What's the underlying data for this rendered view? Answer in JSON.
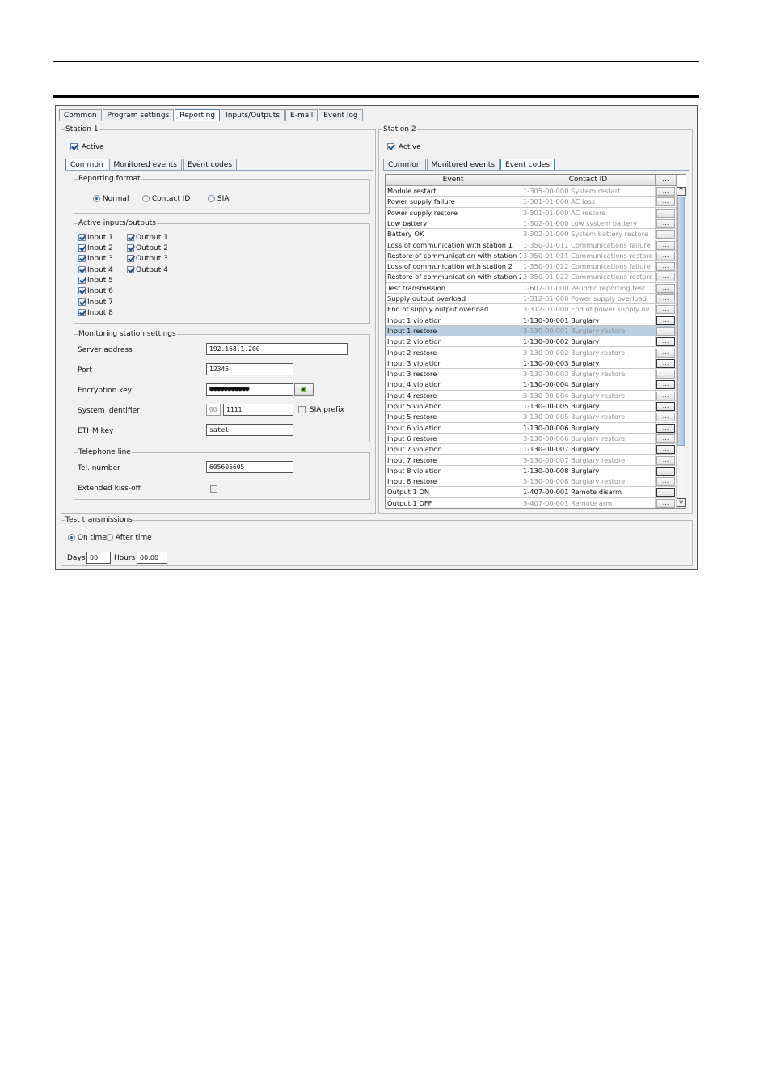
{
  "main_tabs": [
    "Common",
    "Program settings",
    "Reporting",
    "Inputs/Outputs",
    "E-mail",
    "Event log"
  ],
  "station1": {
    "title": "Station 1",
    "active_label": "Active",
    "active_checked": true,
    "subtabs": [
      "Common",
      "Monitored events",
      "Event codes"
    ],
    "reporting_format": {
      "title": "Reporting format",
      "options": [
        "Normal",
        "Contact ID",
        "SIA"
      ],
      "selected": "Normal"
    },
    "active_io": {
      "title": "Active inputs/outputs",
      "inputs": [
        "Input 1",
        "Input 2",
        "Input 3",
        "Input 4",
        "Input 5",
        "Input 6",
        "Input 7",
        "Input 8"
      ],
      "outputs": [
        "Output 1",
        "Output 2",
        "Output 3",
        "Output 4"
      ]
    },
    "monitoring": {
      "title": "Monitoring station settings",
      "server_address_label": "Server address",
      "server_address": "192.168.1.200",
      "port_label": "Port",
      "port": "12345",
      "encryption_key_label": "Encryption key",
      "encryption_key": "●●●●●●●●●●●",
      "system_identifier_label": "System identifier",
      "system_identifier_prefix": "00",
      "system_identifier": "1111",
      "sia_prefix_label": "SIA prefix",
      "ethm_key_label": "ETHM key",
      "ethm_key": "satel"
    },
    "telephone": {
      "title": "Telephone line",
      "tel_number_label": "Tel. number",
      "tel_number": "605605605",
      "extended_kiss_off_label": "Extended kiss-off"
    }
  },
  "station2": {
    "title": "Station 2",
    "active_label": "Active",
    "active_checked": true,
    "subtabs": [
      "Common",
      "Monitored events",
      "Event codes"
    ],
    "table": {
      "headers": [
        "Event",
        "Contact ID",
        "..."
      ],
      "rows": [
        {
          "event": "Module restart",
          "code": "1-305-00-000 System restart",
          "dim": true
        },
        {
          "event": "Power supply failure",
          "code": "1-301-01-000 AC loss",
          "dim": true
        },
        {
          "event": "Power supply restore",
          "code": "3-301-01-000 AC restore",
          "dim": true
        },
        {
          "event": "Low battery",
          "code": "1-302-01-000 Low system battery",
          "dim": true
        },
        {
          "event": "Battery OK",
          "code": "3-302-01-000 System battery restore",
          "dim": true
        },
        {
          "event": "Loss of communication with station 1",
          "code": "1-350-01-011 Communications failure",
          "dim": true
        },
        {
          "event": "Restore of communication with station 1",
          "code": "3-350-01-011 Communications restore",
          "dim": true
        },
        {
          "event": "Loss of communication with station 2",
          "code": "1-350-01-022 Communications failure",
          "dim": true
        },
        {
          "event": "Restore of communication with station 2",
          "code": "3-350-01-022 Communications restore",
          "dim": true
        },
        {
          "event": "Test transmission",
          "code": "1-602-01-000 Periodic reporting test",
          "dim": true
        },
        {
          "event": "Supply output overload",
          "code": "1-312-01-000 Power supply overload",
          "dim": true
        },
        {
          "event": "End of supply output overload",
          "code": "3-312-01-000 End of power supply ov...",
          "dim": true
        },
        {
          "event": "Input 1 violation",
          "code": "1-130-00-001 Burglary",
          "dim": false
        },
        {
          "event": "Input 1 restore",
          "code": "3-130-00-001 Burglary restore",
          "dim": true,
          "selected": true
        },
        {
          "event": "Input 2 violation",
          "code": "1-130-00-002 Burglary",
          "dim": false
        },
        {
          "event": "Input 2 restore",
          "code": "3-130-00-002 Burglary restore",
          "dim": true
        },
        {
          "event": "Input 3 violation",
          "code": "1-130-00-003 Burglary",
          "dim": false
        },
        {
          "event": "Input 3 restore",
          "code": "3-130-00-003 Burglary restore",
          "dim": true
        },
        {
          "event": "Input 4 violation",
          "code": "1-130-00-004 Burglary",
          "dim": false
        },
        {
          "event": "Input 4 restore",
          "code": "3-130-00-004 Burglary restore",
          "dim": true
        },
        {
          "event": "Input 5 violation",
          "code": "1-130-00-005 Burglary",
          "dim": false
        },
        {
          "event": "Input 5 restore",
          "code": "3-130-00-005 Burglary restore",
          "dim": true
        },
        {
          "event": "Input 6 violation",
          "code": "1-130-00-006 Burglary",
          "dim": false
        },
        {
          "event": "Input 6 restore",
          "code": "3-130-00-006 Burglary restore",
          "dim": true
        },
        {
          "event": "Input 7 violation",
          "code": "1-130-00-007 Burglary",
          "dim": false
        },
        {
          "event": "Input 7 restore",
          "code": "3-130-00-007 Burglary restore",
          "dim": true
        },
        {
          "event": "Input 8 violation",
          "code": "1-130-00-008 Burglary",
          "dim": false
        },
        {
          "event": "Input 8 restore",
          "code": "3-130-00-008 Burglary restore",
          "dim": true
        },
        {
          "event": "Output 1 ON",
          "code": "1-407-00-001 Remote disarm",
          "dim": false
        },
        {
          "event": "Output 1 OFF",
          "code": "3-407-00-001 Remote arm",
          "dim": true
        }
      ]
    }
  },
  "test_transmissions": {
    "title": "Test transmissions",
    "options": [
      "On time",
      "After time"
    ],
    "selected": "On time",
    "days_label": "Days",
    "days": "00",
    "hours_label": "Hours",
    "hours": "00:00"
  },
  "colors": {
    "selected_row": "#b8cfe3",
    "active_tab_border": "#4f7fa7",
    "dim_text": "#909090"
  }
}
